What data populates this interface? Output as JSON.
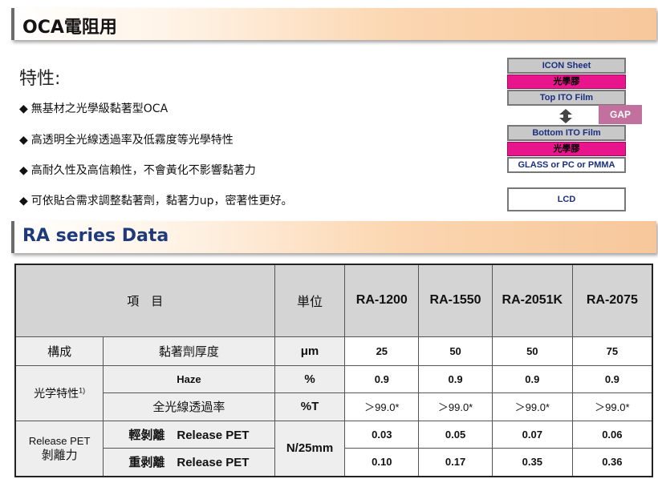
{
  "section1": {
    "title": "OCA電阻用"
  },
  "features": {
    "heading": "特性:",
    "bullet": "◆",
    "items": [
      "無基材之光學級黏著型OCA",
      "高透明全光線透過率及低霧度等光學特性",
      "高耐久性及高信賴性，不會黃化不影響黏著力",
      "可依貼合需求調整黏著劑，黏著力up，密著性更好。"
    ]
  },
  "diagram": {
    "layers": {
      "icon_sheet": "ICON Sheet",
      "adhesive_top": "光學膠",
      "top_ito": "Top  ITO Film",
      "gap": "GAP",
      "bottom_ito": "Bottom  ITO Film",
      "adhesive_bottom": "光學膠",
      "substrate": "GLASS or PC or PMMA",
      "lcd": "LCD"
    },
    "colors": {
      "gray": "#c8c8c8",
      "pink": "#e8158c",
      "gap": "#c2709e",
      "text": "#1a2f80"
    }
  },
  "section2": {
    "title": "RA series Data"
  },
  "table": {
    "header": {
      "item": "項　目",
      "unit": "単位",
      "products": [
        "RA-1200",
        "RA-1550",
        "RA-2051K",
        "RA-2075"
      ]
    },
    "rows": {
      "composition": {
        "group": "構成",
        "name": "黏著劑厚度",
        "unit": "μm",
        "values": [
          "25",
          "50",
          "50",
          "75"
        ]
      },
      "optical_group": "光学特性",
      "optical_note": "1)",
      "haze": {
        "name": "Haze",
        "unit": "%",
        "values": [
          "0.9",
          "0.9",
          "0.9",
          "0.9"
        ]
      },
      "transmittance": {
        "name": "全光線透過率",
        "unit": "%T",
        "values": [
          "＞99.0*",
          "＞99.0*",
          "＞99.0*",
          "＞99.0*"
        ]
      },
      "release_group_1": "Release PET",
      "release_group_2": "剝離力",
      "release_unit": "N/25mm",
      "light": {
        "name": "輕剝離　Release PET",
        "values": [
          "0.03",
          "0.05",
          "0.07",
          "0.06"
        ]
      },
      "heavy": {
        "name": "重剥離　Release PET",
        "values": [
          "0.10",
          "0.17",
          "0.35",
          "0.36"
        ]
      }
    }
  }
}
